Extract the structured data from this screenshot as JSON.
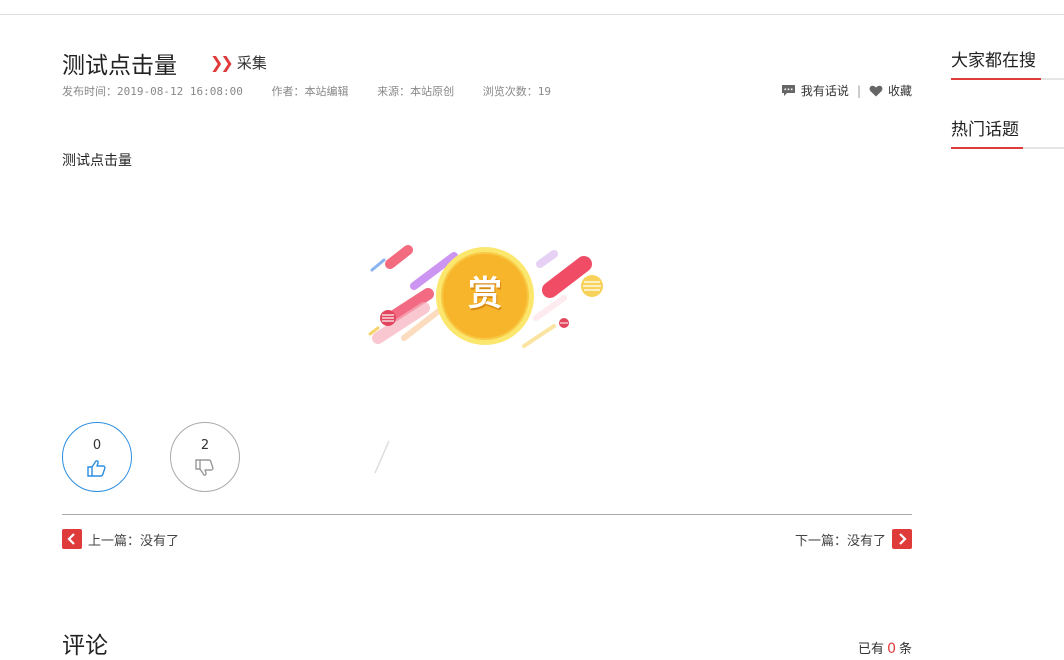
{
  "article": {
    "title": "测试点击量",
    "collect_label": "采集",
    "meta": {
      "publish_time": "发布时间：2019-08-12 16:08:00",
      "author": "作者：本站编辑",
      "source": "来源：本站原创",
      "views": "浏览次数：19"
    },
    "actions": {
      "comment_label": "我有话说",
      "separator": "|",
      "favorite_label": "收藏"
    },
    "body": "测试点击量",
    "reward_char": "赏",
    "votes": {
      "up_count": "0",
      "down_count": "2"
    },
    "nav": {
      "prev": "上一篇：没有了",
      "next": "下一篇：没有了"
    }
  },
  "comments": {
    "title": "评论",
    "count_prefix": "已有",
    "count": "0",
    "count_suffix": "条"
  },
  "sidebar": {
    "blocks": [
      {
        "title": "大家都在搜"
      },
      {
        "title": "热门话题"
      }
    ]
  },
  "colors": {
    "accent_red": "#e03b3b",
    "like_blue": "#2b8de0",
    "coin_gold": "#f7b52c"
  },
  "icons": {
    "chevrons": "double-chevron-right-icon",
    "comment": "comment-bubble-icon",
    "heart": "heart-icon",
    "thumbs_up": "thumbs-up-icon",
    "thumbs_down": "thumbs-down-icon",
    "prev": "chevron-left-icon",
    "next": "chevron-right-icon"
  }
}
